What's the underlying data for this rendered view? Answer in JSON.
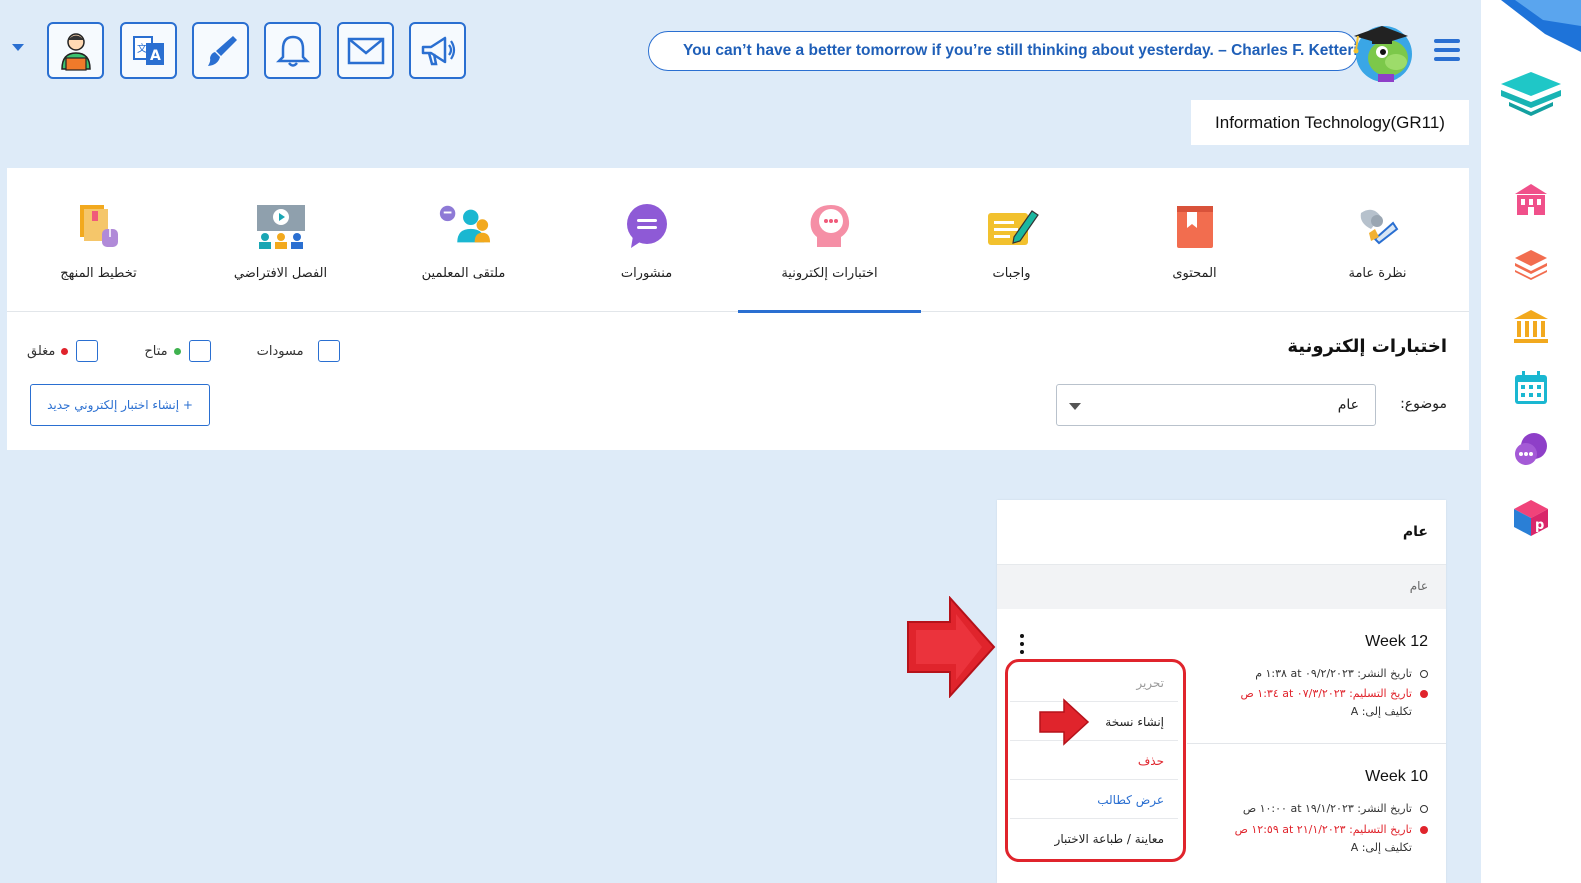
{
  "toolbar": {
    "buttons": [
      {
        "name": "teacher-profile",
        "icon": "teacher-icon"
      },
      {
        "name": "translate",
        "icon": "translate-icon"
      },
      {
        "name": "paint",
        "icon": "brush-icon"
      },
      {
        "name": "notifications",
        "icon": "bell-icon"
      },
      {
        "name": "messages",
        "icon": "mail-icon"
      },
      {
        "name": "announcements",
        "icon": "megaphone-icon"
      }
    ]
  },
  "quote": "You can’t have a better tomorrow if you’re still thinking about yesterday. – Charles F. Kettering",
  "course": "Information Technology(GR11)",
  "tabs": [
    {
      "label": "نظرة عامة",
      "icon": "overview-icon"
    },
    {
      "label": "المحتوى",
      "icon": "content-book-icon"
    },
    {
      "label": "واجبات",
      "icon": "homework-icon"
    },
    {
      "label": "اختبارات إلكترونية",
      "icon": "equiz-icon",
      "active": true
    },
    {
      "label": "منشورات",
      "icon": "posts-icon"
    },
    {
      "label": "ملتقى المعلمين",
      "icon": "teachers-forum-icon"
    },
    {
      "label": "الفصل الافتراضي",
      "icon": "virtual-class-icon"
    },
    {
      "label": "تخطيط المنهج",
      "icon": "curriculum-planning-icon"
    }
  ],
  "section": {
    "title": "اختبارات إلكترونية",
    "filters": {
      "closed": "مغلق",
      "available": "متاح",
      "drafts": "مسودات"
    },
    "topic_label": "موضوع:",
    "topic_value": "عام",
    "create_button": "+ إنشاء اختبار إلكتروني جديد"
  },
  "card": {
    "title": "عام",
    "subheader": "عام",
    "items": [
      {
        "title": "Week 12",
        "publish": "تاريخ النشر: ٠٩/٢/٢٠٢٣ at ١:٣٨ م",
        "due": "تاريخ التسليم: ٠٧/٣/٢٠٢٣ at ١:٣٤ ص",
        "assign": "تكليف إلى: A"
      },
      {
        "title": "Week 10",
        "publish": "تاريخ النشر: ١٩/١/٢٠٢٣ at ١٠:٠٠ ص",
        "due": "تاريخ التسليم: ٢١/١/٢٠٢٣ at ١٢:٥٩ ص",
        "assign": "تكليف إلى: A"
      }
    ]
  },
  "menu": {
    "edit": "تحرير",
    "duplicate": "إنشاء نسخة",
    "delete": "حذف",
    "view_as_student": "عرض كطالب",
    "preview_print": "معاينة / طباعة الاختبار"
  },
  "colors": {
    "accent": "#2a6fd1",
    "danger": "#e0242c",
    "available": "#3fb24f",
    "background": "#deebf8"
  }
}
